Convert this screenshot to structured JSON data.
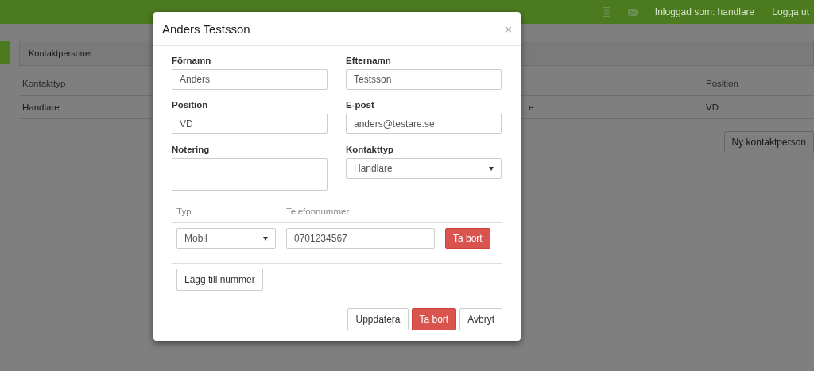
{
  "topbar": {
    "user_label": "Inloggad som: handlare",
    "logout": "Logga ut"
  },
  "page": {
    "panel_title": "Kontaktpersoner",
    "table": {
      "columns": [
        "Kontakttyp",
        "",
        "Position"
      ],
      "rows": [
        [
          "Handlare",
          "e",
          "VD"
        ]
      ]
    },
    "new_button": "Ny kontaktperson"
  },
  "modal": {
    "title": "Anders Testsson",
    "close": "×",
    "fields": [
      {
        "label": "Förnamn",
        "value": "Anders",
        "kind": "text"
      },
      {
        "label": "Efternamn",
        "value": "Testsson",
        "kind": "text"
      },
      {
        "label": "Position",
        "value": "VD",
        "kind": "text"
      },
      {
        "label": "E-post",
        "value": "anders@testare.se",
        "kind": "text"
      },
      {
        "label": "Notering",
        "kind": "textarea"
      },
      {
        "label": "Kontakttyp",
        "value": "Handlare",
        "kind": "select"
      }
    ],
    "phones": {
      "columns": [
        "Typ",
        "Telefonnummer"
      ],
      "rows": [
        {
          "type": "Mobil",
          "number": "0701234567",
          "remove": "Ta bort"
        }
      ]
    },
    "add_button": "Lägg till nummer",
    "buttons": [
      {
        "label": "Uppdatera",
        "kind": "default"
      },
      {
        "label": "Ta bort",
        "kind": "danger"
      },
      {
        "label": "Avbryt",
        "kind": "default"
      }
    ]
  }
}
